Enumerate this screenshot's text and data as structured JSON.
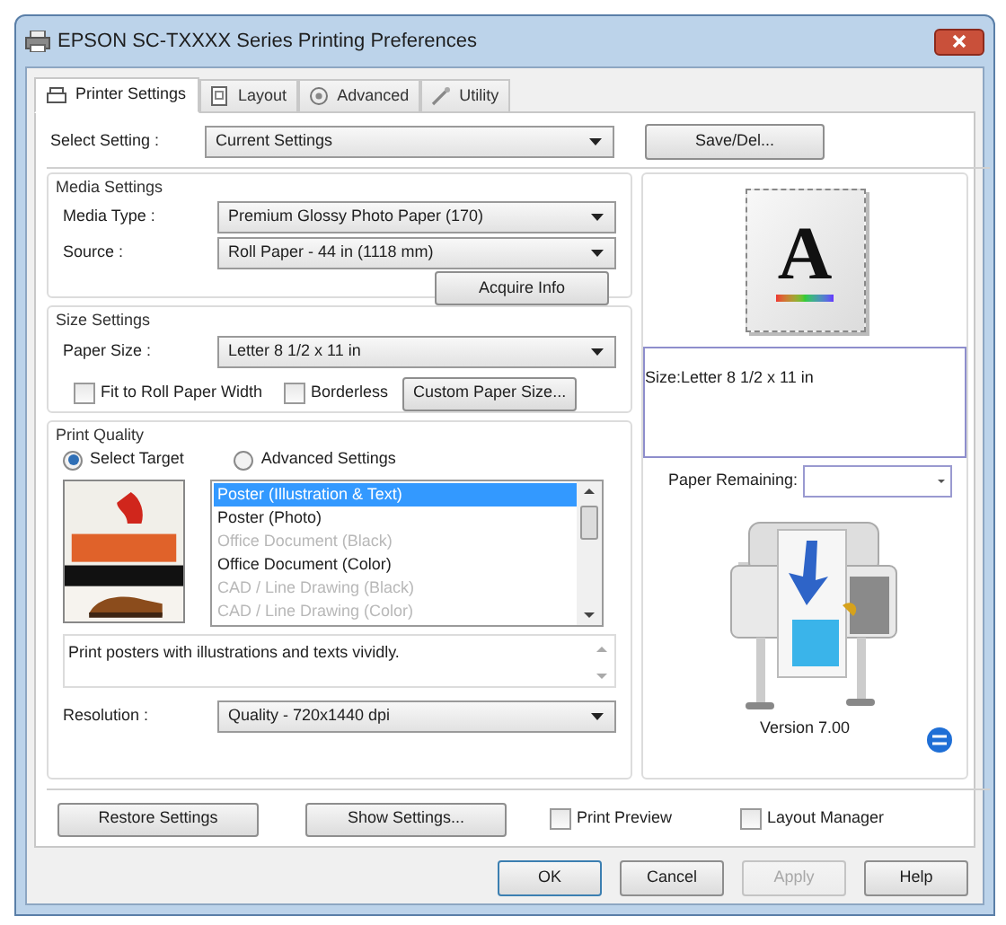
{
  "window": {
    "title": "EPSON SC-TXXXX Series Printing Preferences"
  },
  "tabs": [
    {
      "label": "Printer Settings",
      "kind": "printer",
      "selected": true
    },
    {
      "label": "Layout",
      "kind": "layout",
      "selected": false
    },
    {
      "label": "Advanced",
      "kind": "advanced",
      "selected": false
    },
    {
      "label": "Utility",
      "kind": "utility",
      "selected": false
    }
  ],
  "select_setting": {
    "label": "Select Setting :",
    "value": "Current Settings",
    "button": "Save/Del..."
  },
  "media_settings": {
    "title": "Media Settings",
    "fields": [
      {
        "label": "Media Type :",
        "value": "Premium Glossy Photo Paper (170)"
      },
      {
        "label": "Source :",
        "value": "Roll Paper - 44 in (1118 mm)"
      }
    ],
    "button": "Acquire Info"
  },
  "size_settings": {
    "title": "Size Settings",
    "paper_size": {
      "label": "Paper Size :",
      "value": "Letter 8 1/2 x 11 in"
    },
    "checkboxes": [
      {
        "label": "Fit to Roll Paper Width",
        "checked": false
      },
      {
        "label": "Borderless",
        "checked": false
      }
    ],
    "button": "Custom Paper Size..."
  },
  "print_quality": {
    "title": "Print Quality",
    "modes": [
      {
        "label": "Select Target",
        "selected": true
      },
      {
        "label": "Advanced Settings",
        "selected": false
      }
    ],
    "targets": [
      {
        "label": "Poster (Illustration & Text)",
        "selected": true,
        "disabled": false
      },
      {
        "label": "Poster (Photo)",
        "selected": false,
        "disabled": false
      },
      {
        "label": "Office Document (Black)",
        "selected": false,
        "disabled": true
      },
      {
        "label": "Office Document (Color)",
        "selected": false,
        "disabled": false
      },
      {
        "label": "CAD / Line Drawing (Black)",
        "selected": false,
        "disabled": true
      },
      {
        "label": "CAD / Line Drawing (Color)",
        "selected": false,
        "disabled": true
      }
    ],
    "description": "Print posters with illustrations and texts vividly.",
    "resolution": {
      "label": "Resolution :",
      "value": "Quality - 720x1440 dpi"
    }
  },
  "preview": {
    "sample_glyph": "A",
    "size_info": "Size:Letter 8 1/2 x 11 in",
    "paper_remaining_label": "Paper Remaining:",
    "version": "Version 7.00"
  },
  "footer": {
    "buttons": [
      "Restore Settings",
      "Show Settings..."
    ],
    "checkboxes": [
      {
        "label": "Print Preview",
        "checked": false
      },
      {
        "label": "Layout Manager",
        "checked": false
      }
    ]
  },
  "dialog_buttons": [
    {
      "label": "OK",
      "disabled": false,
      "default": true
    },
    {
      "label": "Cancel",
      "disabled": false,
      "default": false
    },
    {
      "label": "Apply",
      "disabled": true,
      "default": false
    },
    {
      "label": "Help",
      "disabled": false,
      "default": false
    }
  ]
}
